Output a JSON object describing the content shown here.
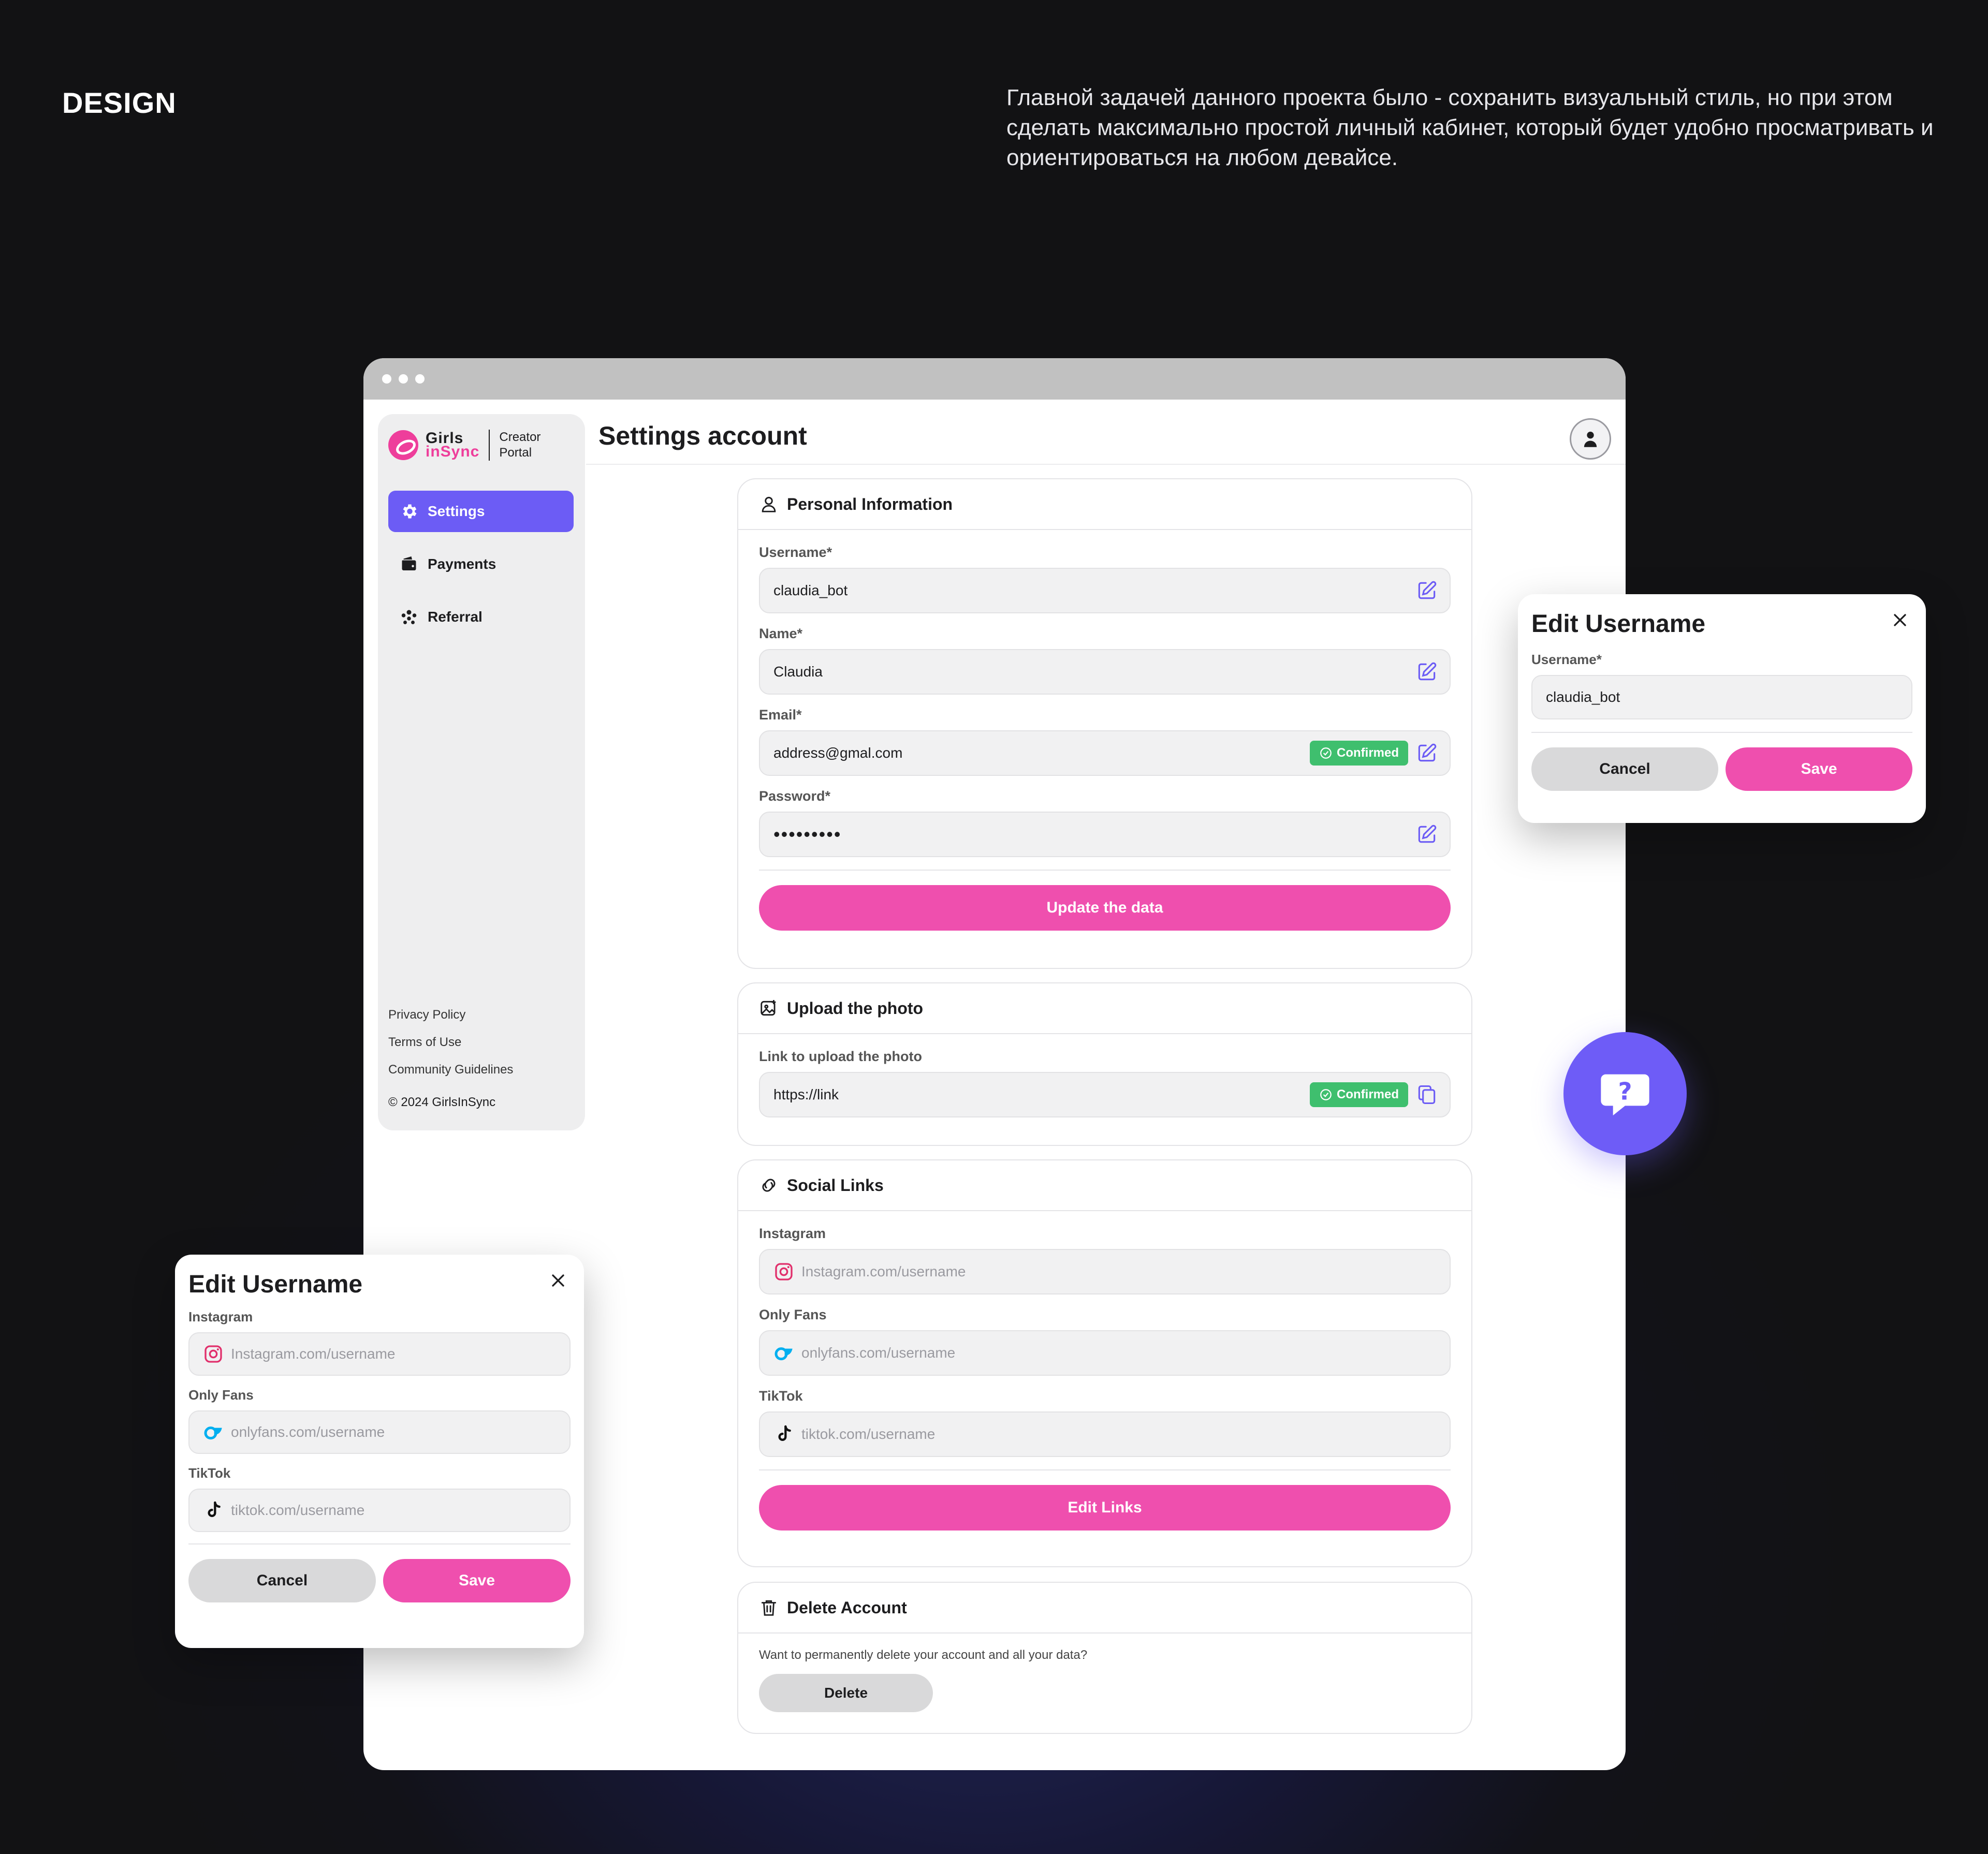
{
  "hero": {
    "title": "DESIGN",
    "description": "Главной задачей данного проекта было - сохранить визуальный стиль, но при этом сделать максимально простой личный кабинет, который будет удобно просматривать и ориентироваться на любом девайсе."
  },
  "colors": {
    "accent": "#6c5cf5",
    "pink": "#ef4fae",
    "confirmed": "#3fbf6e"
  },
  "sidebar": {
    "logo_line1": "Girls",
    "logo_line2": "inSync",
    "logo_sub1": "Creator",
    "logo_sub2": "Portal",
    "items": [
      {
        "label": "Settings",
        "icon": "gear-icon",
        "active": true
      },
      {
        "label": "Payments",
        "icon": "wallet-icon",
        "active": false
      },
      {
        "label": "Referral",
        "icon": "people-icon",
        "active": false
      }
    ],
    "links": [
      "Privacy Policy",
      "Terms of Use",
      "Community Guidelines"
    ],
    "copyright": "© 2024 GirlsInSync"
  },
  "header": {
    "title": "Settings account"
  },
  "personal": {
    "title": "Personal Information",
    "fields": [
      {
        "label": "Username*",
        "value": "claudia_bot"
      },
      {
        "label": "Name*",
        "value": "Claudia"
      },
      {
        "label": "Email*",
        "value": "address@gmal.com",
        "badge": "Confirmed"
      },
      {
        "label": "Password*",
        "value": "•••••••••"
      }
    ],
    "button": "Update the data"
  },
  "photo": {
    "title": "Upload the photo",
    "label": "Link to upload the photo",
    "value": "https://link",
    "badge": "Confirmed"
  },
  "social": {
    "title": "Social Links",
    "fields": [
      {
        "label": "Instagram",
        "placeholder": "Instagram.com/username"
      },
      {
        "label": "Only Fans",
        "placeholder": "onlyfans.com/username"
      },
      {
        "label": "TikTok",
        "placeholder": "tiktok.com/username"
      }
    ],
    "button": "Edit Links"
  },
  "delete": {
    "title": "Delete Account",
    "text": "Want to permanently delete your account and all your data?",
    "button": "Delete"
  },
  "modal_username": {
    "title": "Edit Username",
    "label": "Username*",
    "value": "claudia_bot",
    "cancel": "Cancel",
    "save": "Save"
  },
  "modal_links": {
    "title": "Edit Username",
    "fields": [
      {
        "label": "Instagram",
        "placeholder": "Instagram.com/username"
      },
      {
        "label": "Only Fans",
        "placeholder": "onlyfans.com/username"
      },
      {
        "label": "TikTok",
        "placeholder": "tiktok.com/username"
      }
    ],
    "cancel": "Cancel",
    "save": "Save"
  },
  "help": {
    "icon": "help-chat-icon"
  }
}
